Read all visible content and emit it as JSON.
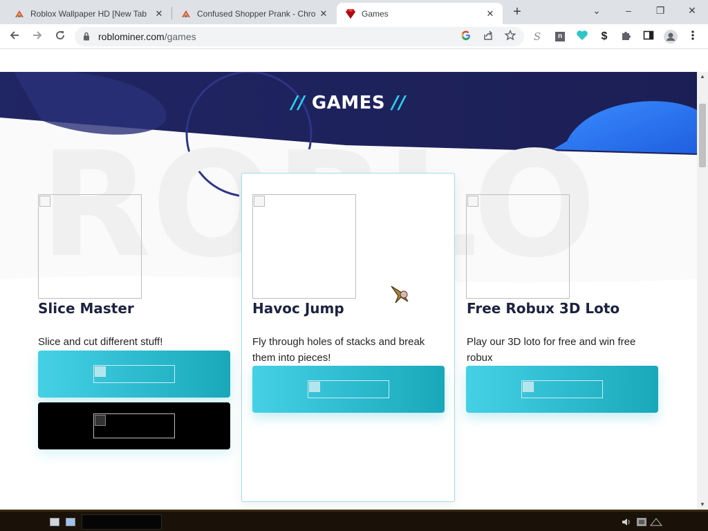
{
  "browser": {
    "tabs": [
      {
        "title": "Roblox Wallpaper HD [New Tab",
        "active": false
      },
      {
        "title": "Confused Shopper Prank - Chro",
        "active": false
      },
      {
        "title": "Games",
        "active": true
      }
    ],
    "close_glyph": "✕",
    "new_tab_glyph": "+",
    "window": {
      "minimize": "–",
      "restore": "❐",
      "close": "✕",
      "tab_search": "⌄"
    },
    "url": {
      "host": "roblominer.com",
      "path": "/games"
    },
    "icons": [
      "back-icon",
      "forward-icon",
      "reload-icon",
      "lock-icon",
      "google-lens-icon",
      "share-icon",
      "bookmark-star-icon",
      "extension-s-icon",
      "extension-n-icon",
      "extension-heart-icon",
      "extension-dollar-icon",
      "puzzle-extensions-icon",
      "side-panel-icon",
      "profile-icon",
      "kebab-menu-icon"
    ],
    "extension_glyphs": {
      "s": "S",
      "n": "n",
      "dollar": "$"
    }
  },
  "page": {
    "title_prefix": "//",
    "title": "GAMES",
    "title_suffix": "//",
    "colors": {
      "hero_navy": "#1f2260",
      "accent_cyan": "#27d3f1",
      "button_cyan": "#2bbcd0"
    },
    "games": [
      {
        "name": "Slice Master",
        "description": "Slice and cut different stuff!",
        "buttons": [
          "cyan",
          "black"
        ]
      },
      {
        "name": "Havoc Jump",
        "description": "Fly through holes of stacks and break them into pieces!",
        "buttons": [
          "cyan"
        ],
        "highlighted": true
      },
      {
        "name": "Free Robux 3D Loto",
        "description": "Play our 3D loto for free and win free robux",
        "buttons": [
          "cyan"
        ]
      }
    ]
  }
}
